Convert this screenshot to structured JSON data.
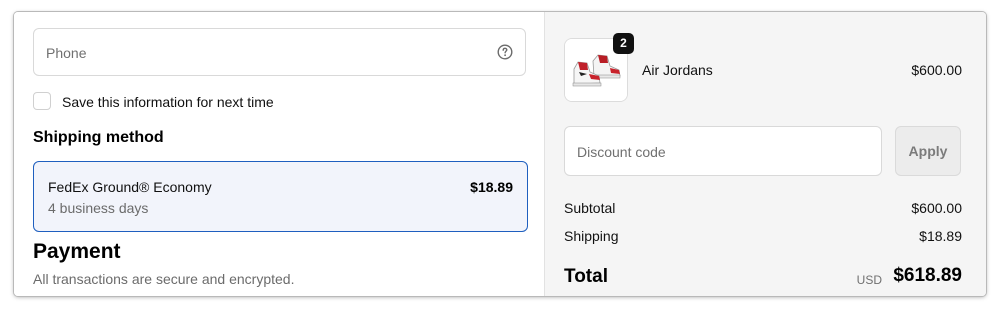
{
  "contact": {
    "phone_placeholder": "Phone",
    "help_icon": "question-circle-icon",
    "save_info_label": "Save this information for next time",
    "save_info_checked": false
  },
  "shipping": {
    "title": "Shipping method",
    "option_name": "FedEx Ground® Economy",
    "option_days": "4 business days",
    "option_price": "$18.89",
    "selected_color": "#1f5fbf"
  },
  "payment": {
    "title": "Payment",
    "subtitle": "All transactions are secure and encrypted."
  },
  "order": {
    "item_name": "Air Jordans",
    "item_price": "$600.00",
    "item_quantity": "2",
    "discount_placeholder": "Discount code",
    "apply_label": "Apply",
    "subtotal_label": "Subtotal",
    "subtotal_value": "$600.00",
    "shipping_label": "Shipping",
    "shipping_value": "$18.89",
    "total_label": "Total",
    "total_currency": "USD",
    "total_value": "$618.89"
  }
}
